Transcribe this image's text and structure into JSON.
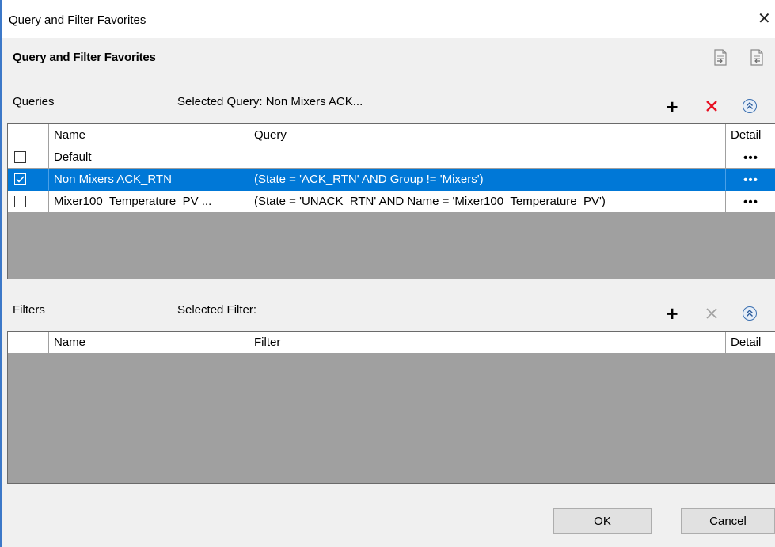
{
  "window": {
    "title": "Query and Filter Favorites"
  },
  "dialog": {
    "header": "Query and Filter Favorites"
  },
  "queries": {
    "label": "Queries",
    "selected_label": "Selected Query: Non Mixers ACK...",
    "columns": {
      "name": "Name",
      "query": "Query",
      "detail": "Detail"
    },
    "rows": [
      {
        "checked": false,
        "selected": false,
        "name": "Default",
        "query": "",
        "detail": "•••"
      },
      {
        "checked": true,
        "selected": true,
        "name": "Non Mixers ACK_RTN",
        "query": "(State = 'ACK_RTN' AND Group != 'Mixers')",
        "detail": "•••"
      },
      {
        "checked": false,
        "selected": false,
        "name": "Mixer100_Temperature_PV ...",
        "query": "(State = 'UNACK_RTN' AND Name = 'Mixer100_Temperature_PV')",
        "detail": "•••"
      }
    ]
  },
  "filters": {
    "label": "Filters",
    "selected_label": "Selected Filter:",
    "columns": {
      "name": "Name",
      "filter": "Filter",
      "detail": "Detail"
    },
    "rows": []
  },
  "buttons": {
    "ok": "OK",
    "cancel": "Cancel"
  },
  "icons": {
    "close": "✕",
    "add": "+",
    "remove": "✕",
    "collapse": "double-chevron-up",
    "export": "export-document",
    "import": "import-document"
  },
  "colors": {
    "selection": "#0078d7",
    "remove_active": "#e81123",
    "remove_disabled": "#a0a0a0",
    "grid_empty": "#a0a0a0"
  }
}
